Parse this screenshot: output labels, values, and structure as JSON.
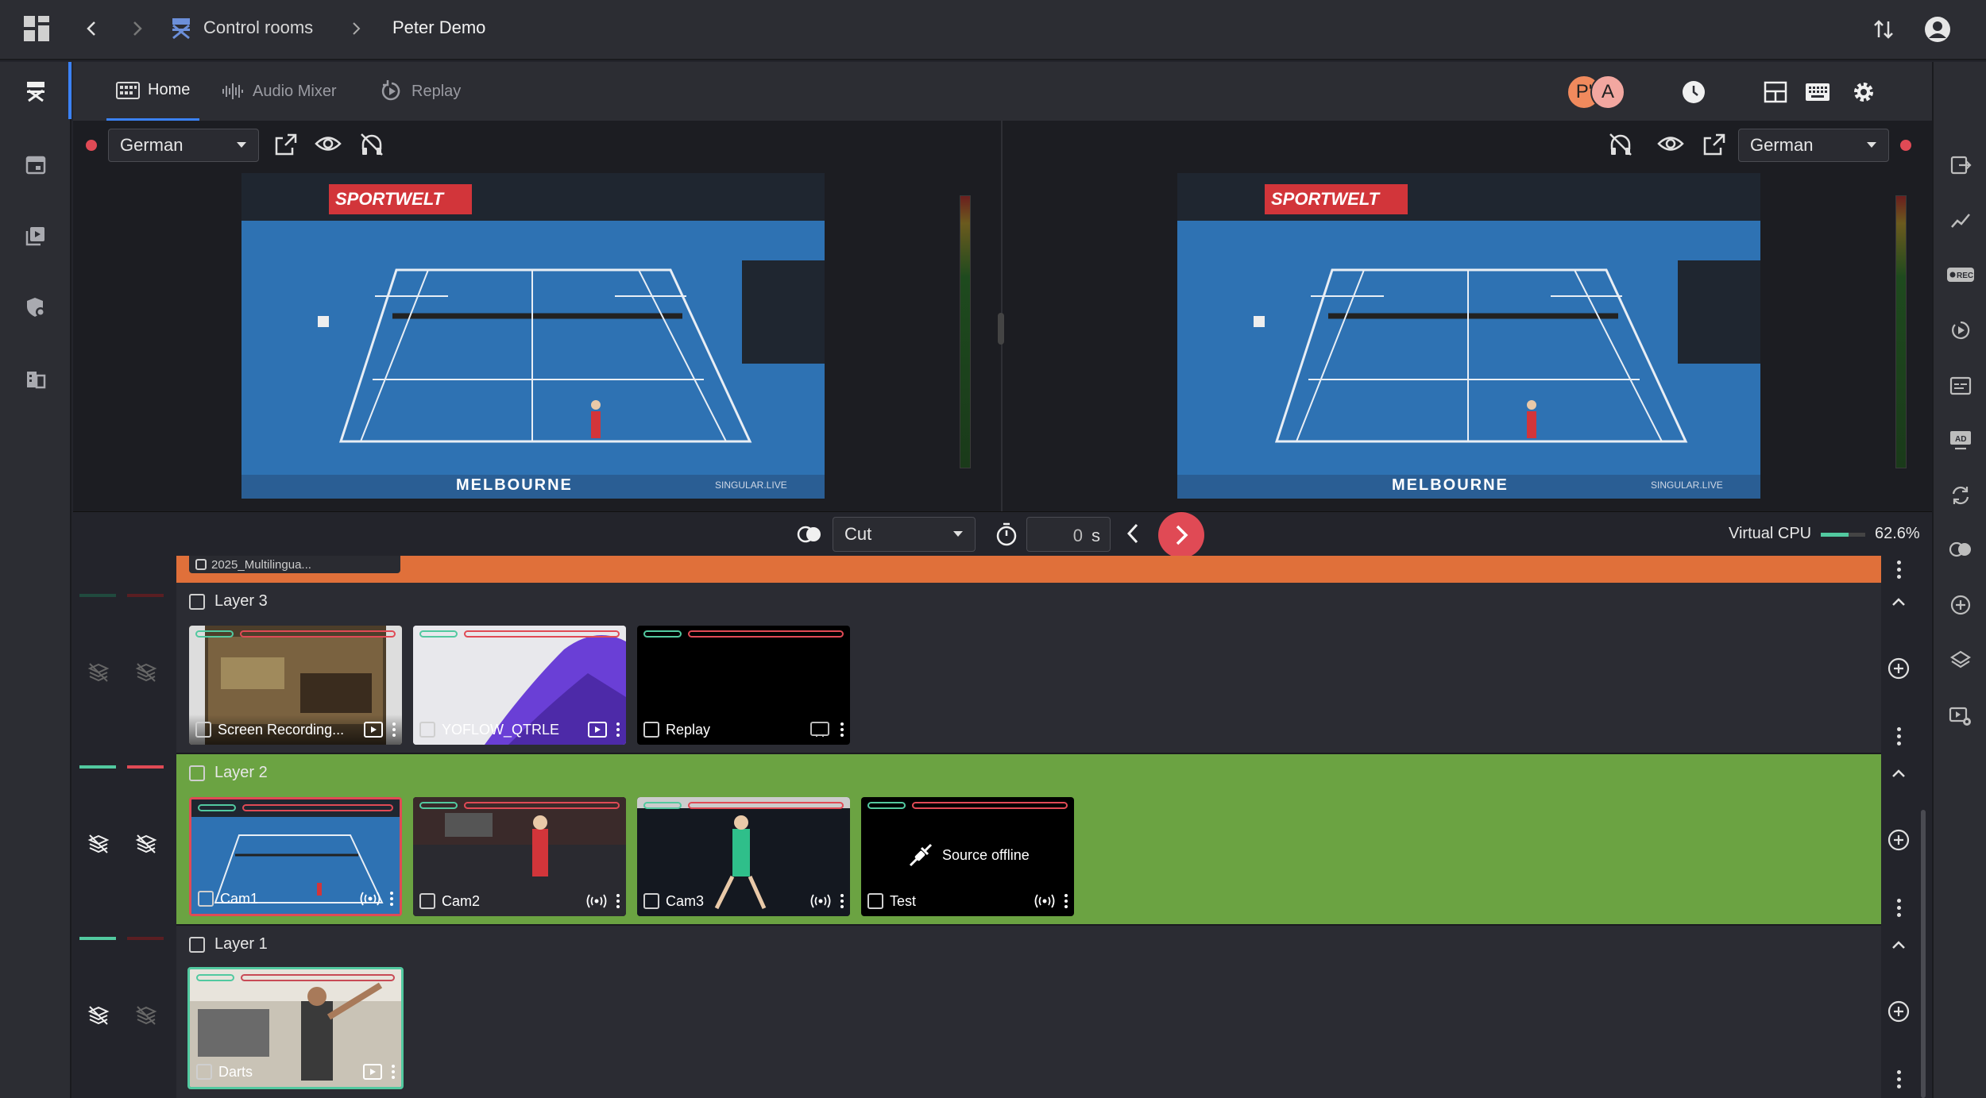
{
  "breadcrumb": {
    "section": "Control rooms",
    "page": "Peter Demo"
  },
  "tabs": [
    {
      "label": "Home",
      "icon": "grid-icon",
      "active": true
    },
    {
      "label": "Audio Mixer",
      "icon": "waveform-icon",
      "active": false
    },
    {
      "label": "Replay",
      "icon": "replay-icon",
      "active": false
    }
  ],
  "avatars": [
    "P'",
    "A"
  ],
  "preview": {
    "left_language": "German",
    "right_language": "German",
    "venue_banner": "MELBOURNE",
    "sponsor_banner": "SPORTWELT",
    "watermark": "SINGULAR.LIVE"
  },
  "transition": {
    "type": "Cut",
    "duration": "0",
    "unit": "s"
  },
  "cpu": {
    "label": "Virtual CPU",
    "value": "62.6%",
    "fraction": 0.626
  },
  "top_layer": {
    "label": "2025_Multilingua..."
  },
  "layers": [
    {
      "name": "Layer 3",
      "sources": [
        {
          "label": "Screen Recording...",
          "kind": "media"
        },
        {
          "label": "YOFLOW_QTRLE",
          "kind": "media"
        },
        {
          "label": "Replay",
          "kind": "replay"
        }
      ]
    },
    {
      "name": "Layer 2",
      "sources": [
        {
          "label": "Cam1",
          "kind": "live"
        },
        {
          "label": "Cam2",
          "kind": "live"
        },
        {
          "label": "Cam3",
          "kind": "live"
        },
        {
          "label": "Test",
          "kind": "live",
          "status": "Source offline"
        }
      ]
    },
    {
      "name": "Layer 1",
      "sources": [
        {
          "label": "Darts",
          "kind": "media"
        }
      ]
    }
  ],
  "colors": {
    "accent": "#3b82f6",
    "live_red": "#e04a55",
    "layer_green": "#6ba342",
    "layer_orange": "#e0703a",
    "meter_green": "#52c9a0"
  }
}
